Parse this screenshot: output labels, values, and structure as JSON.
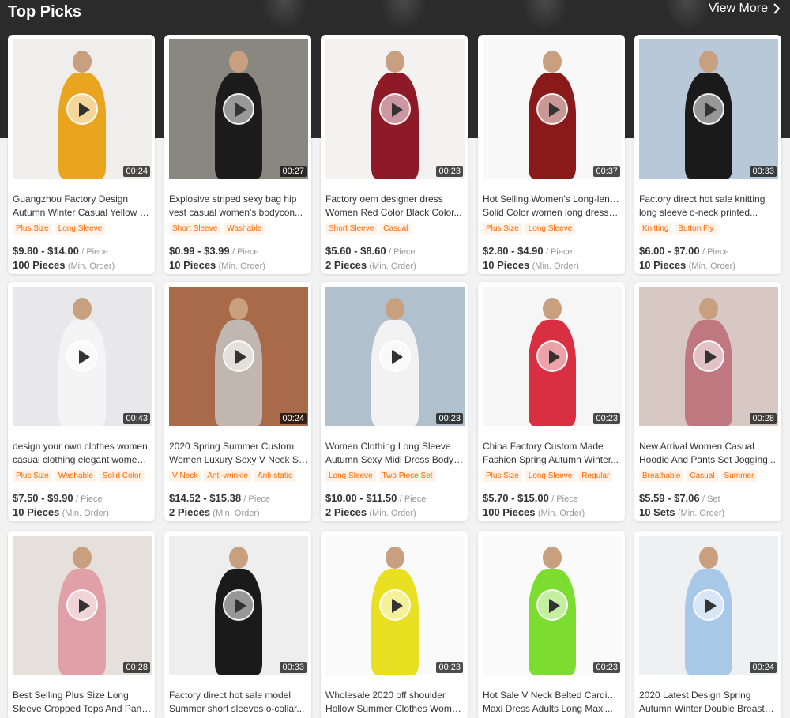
{
  "header": {
    "title": "Top Picks",
    "view_more": "View More"
  },
  "products": [
    {
      "title_l1": "Guangzhou Factory Design",
      "title_l2": "Autumn Winter Casual Yellow V...",
      "tags": [
        "Plus Size",
        "Long Sleeve"
      ],
      "price": "$9.80 - $14.00",
      "unit": "/ Piece",
      "moq": "100 Pieces",
      "moq_note": "(Min. Order)",
      "duration": "00:24",
      "bg": "#f0eeec",
      "garment": "#e9a520"
    },
    {
      "title_l1": "Explosive striped sexy bag hip",
      "title_l2": "vest casual women's bodycon...",
      "tags": [
        "Short Sleeve",
        "Washable"
      ],
      "price": "$0.99 - $3.99",
      "unit": "/ Piece",
      "moq": "10 Pieces",
      "moq_note": "(Min. Order)",
      "duration": "00:27",
      "bg": "#8a8680",
      "garment": "#1c1c1c"
    },
    {
      "title_l1": "Factory oem designer dress",
      "title_l2": "Women Red Color Black Color...",
      "tags": [
        "Short Sleeve",
        "Casual"
      ],
      "price": "$5.60 - $8.60",
      "unit": "/ Piece",
      "moq": "2 Pieces",
      "moq_note": "(Min. Order)",
      "duration": "00:23",
      "bg": "#f4f2f0",
      "garment": "#8e1a28"
    },
    {
      "title_l1": "Hot Selling Women's Long-length",
      "title_l2": "Solid Color women long dresses...",
      "tags": [
        "Plus Size",
        "Long Sleeve"
      ],
      "price": "$2.80 - $4.90",
      "unit": "/ Piece",
      "moq": "10 Pieces",
      "moq_note": "(Min. Order)",
      "duration": "00:37",
      "bg": "#f8f8f8",
      "garment": "#8a1a1a"
    },
    {
      "title_l1": "Factory direct hot sale knitting",
      "title_l2": "long sleeve o-neck printed...",
      "tags": [
        "Knitting",
        "Button Fly"
      ],
      "price": "$6.00 - $7.00",
      "unit": "/ Piece",
      "moq": "10 Pieces",
      "moq_note": "(Min. Order)",
      "duration": "00:33",
      "bg": "#b8c8d8",
      "garment": "#1a1a1a"
    },
    {
      "title_l1": "design your own clothes women",
      "title_l2": "casual clothing elegant womens...",
      "tags": [
        "Plus Size",
        "Washable",
        "Solid Color"
      ],
      "price": "$7.50 - $9.90",
      "unit": "/ Piece",
      "moq": "10 Pieces",
      "moq_note": "(Min. Order)",
      "duration": "00:43",
      "bg": "#e8e8ea",
      "garment": "#f4f4f4"
    },
    {
      "title_l1": "2020 Spring Summer Custom",
      "title_l2": "Women Luxury Sexy V Neck Slin...",
      "tags": [
        "V Neck",
        "Anti-wrinkle",
        "Anti-static"
      ],
      "price": "$14.52 - $15.38",
      "unit": "/ Piece",
      "moq": "2 Pieces",
      "moq_note": "(Min. Order)",
      "duration": "00:24",
      "bg": "#a86a48",
      "garment": "#c0b8b0"
    },
    {
      "title_l1": "Women Clothing Long Sleeve",
      "title_l2": "Autumn Sexy Midi Dress Bodyco...",
      "tags": [
        "Long Sleeve",
        "Two Piece Set"
      ],
      "price": "$10.00 - $11.50",
      "unit": "/ Piece",
      "moq": "2 Pieces",
      "moq_note": "(Min. Order)",
      "duration": "00:23",
      "bg": "#b0c0cc",
      "garment": "#f2f2f2"
    },
    {
      "title_l1": "China Factory Custom Made",
      "title_l2": "Fashion Spring Autumn Winter...",
      "tags": [
        "Plus Size",
        "Long Sleeve",
        "Regular"
      ],
      "price": "$5.70 - $15.00",
      "unit": "/ Piece",
      "moq": "100 Pieces",
      "moq_note": "(Min. Order)",
      "duration": "00:23",
      "bg": "#f6f6f6",
      "garment": "#d83040"
    },
    {
      "title_l1": "New Arrival Women Casual",
      "title_l2": "Hoodie And Pants Set Jogging...",
      "tags": [
        "Breathable",
        "Casual",
        "Summer"
      ],
      "price": "$5.59 - $7.06",
      "unit": "/ Set",
      "moq": "10 Sets",
      "moq_note": "(Min. Order)",
      "duration": "00:28",
      "bg": "#d8c8c4",
      "garment": "#c07880"
    },
    {
      "title_l1": "Best Selling Plus Size Long",
      "title_l2": "Sleeve Cropped Tops And Pants...",
      "tags": [],
      "price": "",
      "unit": "",
      "moq": "",
      "moq_note": "",
      "duration": "00:28",
      "bg": "#e6e0dc",
      "garment": "#e0a0a8"
    },
    {
      "title_l1": "Factory direct hot sale model",
      "title_l2": "Summer short sleeves o-collar...",
      "tags": [],
      "price": "",
      "unit": "",
      "moq": "",
      "moq_note": "",
      "duration": "00:33",
      "bg": "#eeeeee",
      "garment": "#1a1a1a"
    },
    {
      "title_l1": "Wholesale 2020 off shoulder",
      "title_l2": "Hollow Summer Clothes Women...",
      "tags": [],
      "price": "",
      "unit": "",
      "moq": "",
      "moq_note": "",
      "duration": "00:23",
      "bg": "#fafafa",
      "garment": "#e8e020"
    },
    {
      "title_l1": "Hot Sale V Neck Belted Cardigan",
      "title_l2": "Maxi Dress Adults Long Maxi...",
      "tags": [],
      "price": "",
      "unit": "",
      "moq": "",
      "moq_note": "",
      "duration": "00:23",
      "bg": "#fafafa",
      "garment": "#7cdc30"
    },
    {
      "title_l1": "2020 Latest Design Spring",
      "title_l2": "Autumn Winter Double Breasted...",
      "tags": [],
      "price": "",
      "unit": "",
      "moq": "",
      "moq_note": "",
      "duration": "00:24",
      "bg": "#eef0f2",
      "garment": "#a8c8e8"
    }
  ]
}
